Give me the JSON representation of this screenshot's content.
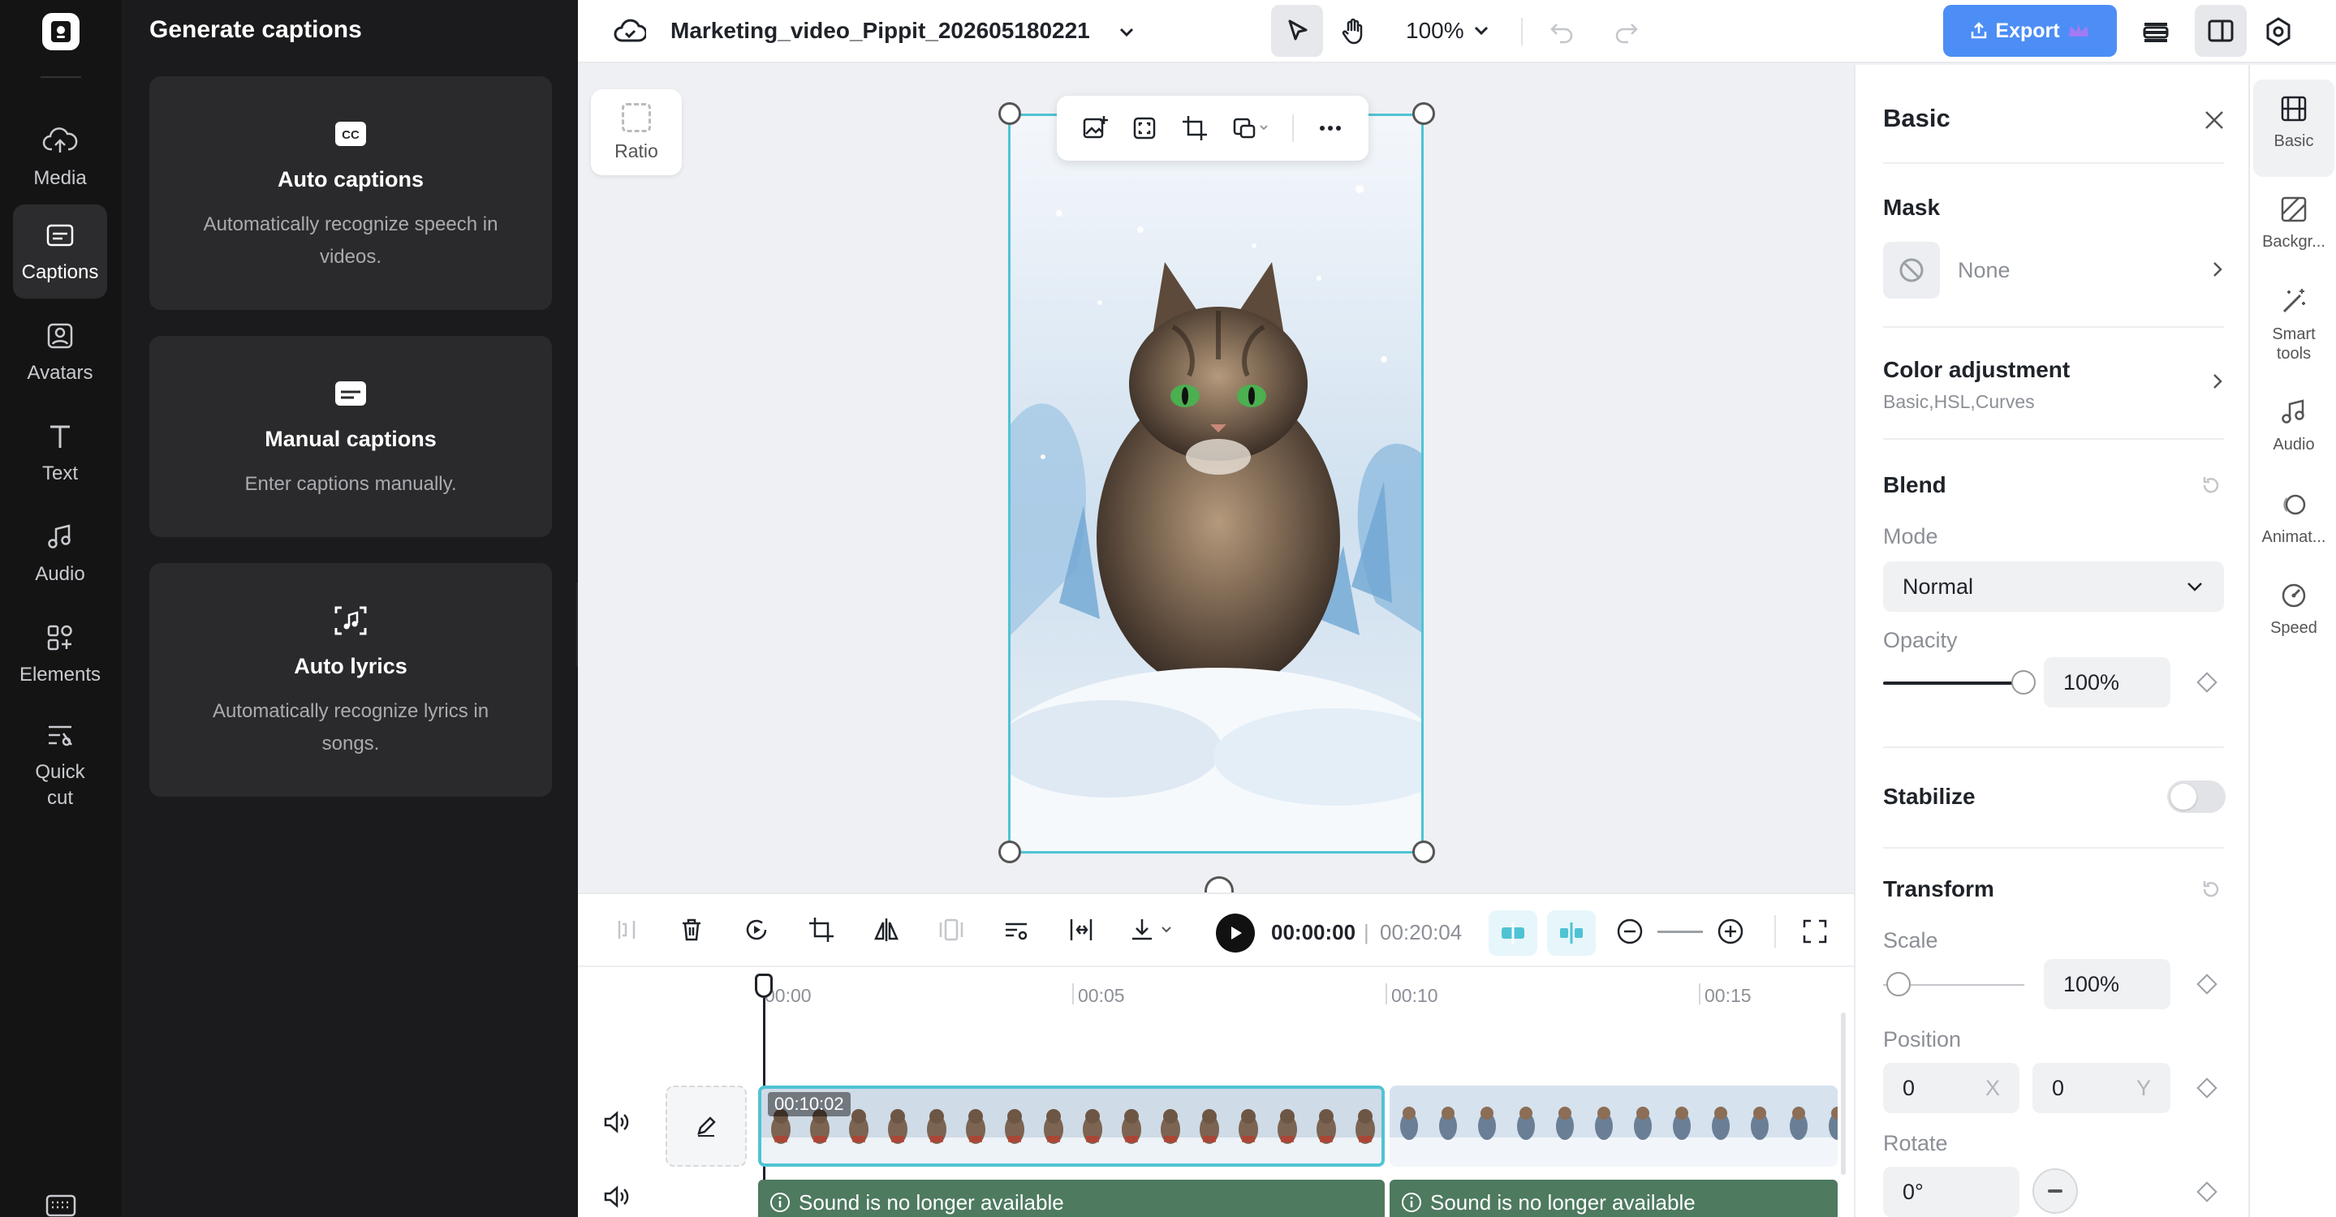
{
  "nav": {
    "items": [
      {
        "id": "media",
        "label": "Media",
        "icon": "cloud-upload-icon"
      },
      {
        "id": "captions",
        "label": "Captions",
        "icon": "captions-icon",
        "active": true
      },
      {
        "id": "avatars",
        "label": "Avatars",
        "icon": "avatar-icon"
      },
      {
        "id": "text",
        "label": "Text",
        "icon": "text-icon"
      },
      {
        "id": "audio",
        "label": "Audio",
        "icon": "music-note-icon"
      },
      {
        "id": "elements",
        "label": "Elements",
        "icon": "elements-icon"
      },
      {
        "id": "quickcut",
        "label": "Quick\ncut",
        "icon": "quick-cut-icon"
      }
    ]
  },
  "captions_panel": {
    "title": "Generate captions",
    "cards": [
      {
        "title": "Auto captions",
        "desc": "Automatically recognize speech in videos.",
        "icon": "cc-icon"
      },
      {
        "title": "Manual captions",
        "desc": "Enter captions manually.",
        "icon": "subtitle-icon"
      },
      {
        "title": "Auto lyrics",
        "desc": "Automatically recognize lyrics in songs.",
        "icon": "lyrics-scan-icon"
      }
    ]
  },
  "topbar": {
    "project_name": "Marketing_video_Pippit_202605180221",
    "zoom": "100%",
    "export_label": "Export",
    "accent": "#4c8ef5"
  },
  "canvas": {
    "ratio_label": "Ratio"
  },
  "props": {
    "title": "Basic",
    "mask": {
      "label": "Mask",
      "value": "None"
    },
    "color_adjustment": {
      "label": "Color adjustment",
      "sub": "Basic,HSL,Curves"
    },
    "blend": {
      "label": "Blend",
      "mode_label": "Mode",
      "mode_value": "Normal",
      "opacity_label": "Opacity",
      "opacity_value": "100%",
      "opacity_fraction": 1.0
    },
    "stabilize": {
      "label": "Stabilize",
      "on": false
    },
    "transform": {
      "label": "Transform",
      "scale_label": "Scale",
      "scale_value": "100%",
      "position_label": "Position",
      "pos_x": "0",
      "pos_x_axis": "X",
      "pos_y": "0",
      "pos_y_axis": "Y",
      "rotate_label": "Rotate",
      "rotate_value": "0°"
    }
  },
  "right_tabs": [
    {
      "label": "Basic",
      "icon": "film-icon",
      "active": true
    },
    {
      "label": "Backgr...",
      "icon": "background-icon"
    },
    {
      "label": "Smart\ntools",
      "icon": "magic-wand-icon"
    },
    {
      "label": "Audio",
      "icon": "music-note-icon"
    },
    {
      "label": "Animat...",
      "icon": "animation-icon"
    },
    {
      "label": "Speed",
      "icon": "speed-icon"
    }
  ],
  "timeline": {
    "current_time": "00:00:00",
    "total_time": "00:20:04",
    "ticks": [
      "00:00",
      "00:05",
      "00:10",
      "00:15"
    ],
    "clip1_duration": "00:10:02",
    "audio_message": "Sound is no longer available"
  }
}
